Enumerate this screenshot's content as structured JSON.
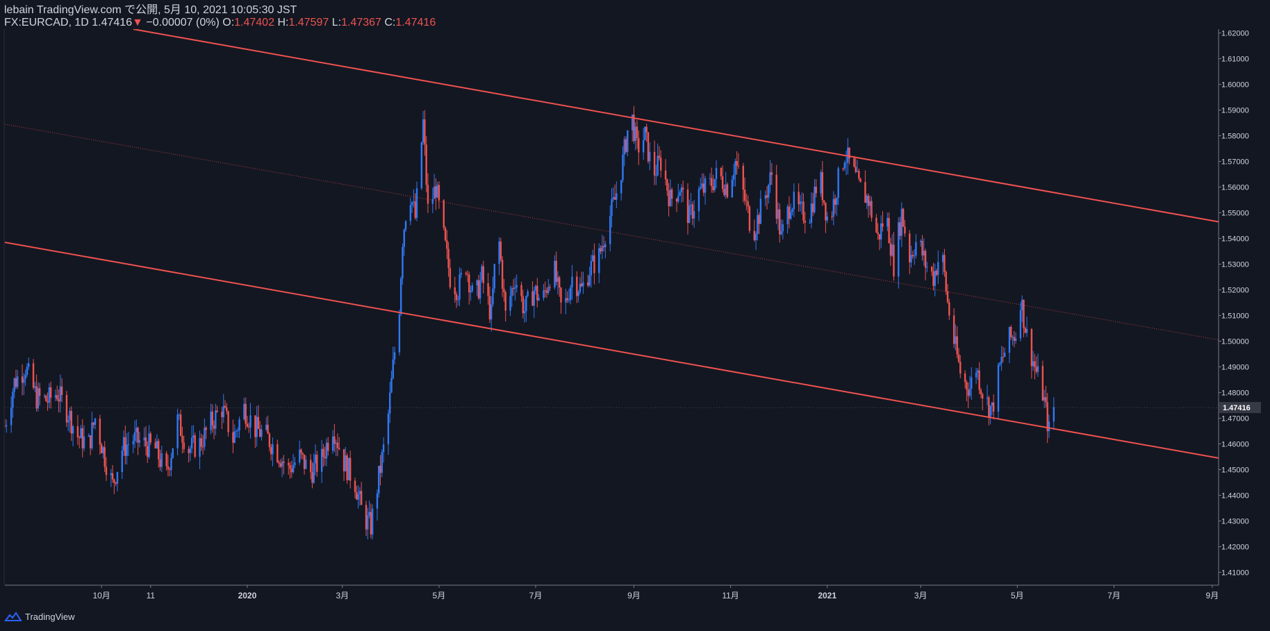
{
  "header": {
    "publish_line": "lebain TradingView.com で公開, 5月 10, 2021 10:05:30 JST",
    "symbol": "FX:EURCAD, 1D",
    "last": "1.47416",
    "arrow": "▼",
    "change": "−0.00007 (0%)",
    "o_label": "O:",
    "o_value": "1.47402",
    "h_label": "H:",
    "h_value": "1.47597",
    "l_label": "L:",
    "l_value": "1.47367",
    "c_label": "C:",
    "c_value": "1.47416"
  },
  "footer": {
    "brand": "TradingView"
  },
  "colors": {
    "background": "#131722",
    "up": "#2962ff",
    "up_light": "#3179f5",
    "down": "#ef5350",
    "channel": "#f0524f",
    "axis_text": "#d1d4dc",
    "price_tag_bg": "#363a45"
  },
  "chart_data": {
    "type": "candlestick",
    "title": "",
    "ylim": [
      1.405,
      1.6215
    ],
    "y_ticks": [
      "1.41000",
      "1.42000",
      "1.43000",
      "1.44000",
      "1.45000",
      "1.46000",
      "1.47000",
      "1.48000",
      "1.49000",
      "1.50000",
      "1.51000",
      "1.52000",
      "1.53000",
      "1.54000",
      "1.55000",
      "1.56000",
      "1.57000",
      "1.58000",
      "1.59000",
      "1.60000",
      "1.61000",
      "1.62000"
    ],
    "y_tick_values": [
      1.41,
      1.42,
      1.43,
      1.44,
      1.45,
      1.46,
      1.47,
      1.48,
      1.49,
      1.5,
      1.51,
      1.52,
      1.53,
      1.54,
      1.55,
      1.56,
      1.57,
      1.58,
      1.59,
      1.6,
      1.61,
      1.62
    ],
    "x_tick_labels": [
      "10月",
      "11",
      "2020",
      "3月",
      "5月",
      "7月",
      "9月",
      "11月",
      "2021",
      "3月",
      "5月",
      "7月",
      "9月"
    ],
    "x_tick_dates": [
      "2019-10-01",
      "2019-11-01",
      "2020-01-01",
      "2020-03-01",
      "2020-05-01",
      "2020-07-01",
      "2020-09-01",
      "2020-11-01",
      "2021-01-01",
      "2021-03-01",
      "2021-05-01",
      "2021-07-01",
      "2021-09-01"
    ],
    "x_range": [
      "2019-08-01",
      "2021-09-05"
    ],
    "last_price": 1.47416,
    "last_price_label": "1.47416",
    "path_points": [
      [
        "2019-08-01",
        1.467
      ],
      [
        "2019-08-07",
        1.484
      ],
      [
        "2019-08-14",
        1.49
      ],
      [
        "2019-08-21",
        1.478
      ],
      [
        "2019-08-28",
        1.477
      ],
      [
        "2019-09-03",
        1.48
      ],
      [
        "2019-09-10",
        1.472
      ],
      [
        "2019-09-16",
        1.463
      ],
      [
        "2019-09-23",
        1.46
      ],
      [
        "2019-09-27",
        1.47
      ],
      [
        "2019-10-03",
        1.455
      ],
      [
        "2019-10-08",
        1.444
      ],
      [
        "2019-10-14",
        1.458
      ],
      [
        "2019-10-21",
        1.462
      ],
      [
        "2019-10-28",
        1.46
      ],
      [
        "2019-11-04",
        1.458
      ],
      [
        "2019-11-11",
        1.448
      ],
      [
        "2019-11-18",
        1.469
      ],
      [
        "2019-11-25",
        1.458
      ],
      [
        "2019-12-02",
        1.46
      ],
      [
        "2019-12-09",
        1.468
      ],
      [
        "2019-12-16",
        1.474
      ],
      [
        "2019-12-23",
        1.462
      ],
      [
        "2019-12-30",
        1.474
      ],
      [
        "2020-01-06",
        1.466
      ],
      [
        "2020-01-13",
        1.463
      ],
      [
        "2020-01-20",
        1.457
      ],
      [
        "2020-01-27",
        1.45
      ],
      [
        "2020-02-03",
        1.455
      ],
      [
        "2020-02-10",
        1.449
      ],
      [
        "2020-02-17",
        1.454
      ],
      [
        "2020-02-24",
        1.467
      ],
      [
        "2020-03-02",
        1.453
      ],
      [
        "2020-03-09",
        1.445
      ],
      [
        "2020-03-14",
        1.432
      ],
      [
        "2020-03-19",
        1.428
      ],
      [
        "2020-03-24",
        1.447
      ],
      [
        "2020-03-29",
        1.465
      ],
      [
        "2020-04-02",
        1.49
      ],
      [
        "2020-04-06",
        1.514
      ],
      [
        "2020-04-08",
        1.54
      ],
      [
        "2020-04-12",
        1.56
      ],
      [
        "2020-04-16",
        1.548
      ],
      [
        "2020-04-21",
        1.585
      ],
      [
        "2020-04-24",
        1.551
      ],
      [
        "2020-04-29",
        1.56
      ],
      [
        "2020-05-04",
        1.54
      ],
      [
        "2020-05-08",
        1.525
      ],
      [
        "2020-05-13",
        1.52
      ],
      [
        "2020-05-18",
        1.53
      ],
      [
        "2020-05-23",
        1.515
      ],
      [
        "2020-05-28",
        1.525
      ],
      [
        "2020-06-03",
        1.51
      ],
      [
        "2020-06-07",
        1.545
      ],
      [
        "2020-06-12",
        1.51
      ],
      [
        "2020-06-18",
        1.525
      ],
      [
        "2020-06-24",
        1.512
      ],
      [
        "2020-06-30",
        1.52
      ],
      [
        "2020-07-05",
        1.515
      ],
      [
        "2020-07-12",
        1.53
      ],
      [
        "2020-07-18",
        1.51
      ],
      [
        "2020-07-24",
        1.525
      ],
      [
        "2020-07-30",
        1.52
      ],
      [
        "2020-08-04",
        1.528
      ],
      [
        "2020-08-10",
        1.533
      ],
      [
        "2020-08-15",
        1.545
      ],
      [
        "2020-08-20",
        1.555
      ],
      [
        "2020-08-25",
        1.57
      ],
      [
        "2020-08-30",
        1.59
      ],
      [
        "2020-09-03",
        1.575
      ],
      [
        "2020-09-08",
        1.58
      ],
      [
        "2020-09-13",
        1.565
      ],
      [
        "2020-09-18",
        1.57
      ],
      [
        "2020-09-24",
        1.555
      ],
      [
        "2020-09-30",
        1.56
      ],
      [
        "2020-10-06",
        1.548
      ],
      [
        "2020-10-12",
        1.558
      ],
      [
        "2020-10-18",
        1.56
      ],
      [
        "2020-10-24",
        1.565
      ],
      [
        "2020-10-30",
        1.56
      ],
      [
        "2020-11-04",
        1.57
      ],
      [
        "2020-11-10",
        1.555
      ],
      [
        "2020-11-15",
        1.542
      ],
      [
        "2020-11-21",
        1.553
      ],
      [
        "2020-11-27",
        1.565
      ],
      [
        "2020-12-03",
        1.54
      ],
      [
        "2020-12-09",
        1.555
      ],
      [
        "2020-12-15",
        1.55
      ],
      [
        "2020-12-21",
        1.55
      ],
      [
        "2020-12-27",
        1.565
      ],
      [
        "2021-01-02",
        1.545
      ],
      [
        "2021-01-07",
        1.56
      ],
      [
        "2021-01-12",
        1.573
      ],
      [
        "2021-01-16",
        1.568
      ],
      [
        "2021-01-21",
        1.56
      ],
      [
        "2021-01-27",
        1.555
      ],
      [
        "2021-02-02",
        1.54
      ],
      [
        "2021-02-07",
        1.55
      ],
      [
        "2021-02-12",
        1.53
      ],
      [
        "2021-02-17",
        1.55
      ],
      [
        "2021-02-22",
        1.533
      ],
      [
        "2021-02-27",
        1.54
      ],
      [
        "2021-03-04",
        1.53
      ],
      [
        "2021-03-09",
        1.525
      ],
      [
        "2021-03-14",
        1.536
      ],
      [
        "2021-03-18",
        1.515
      ],
      [
        "2021-03-22",
        1.5
      ],
      [
        "2021-03-27",
        1.485
      ],
      [
        "2021-04-01",
        1.482
      ],
      [
        "2021-04-05",
        1.49
      ],
      [
        "2021-04-10",
        1.478
      ],
      [
        "2021-04-15",
        1.473
      ],
      [
        "2021-04-20",
        1.49
      ],
      [
        "2021-04-25",
        1.5
      ],
      [
        "2021-04-30",
        1.503
      ],
      [
        "2021-05-03",
        1.517
      ],
      [
        "2021-05-07",
        1.502
      ],
      [
        "2021-05-12",
        1.49
      ],
      [
        "2021-05-17",
        1.48
      ],
      [
        "2021-05-21",
        1.465
      ],
      [
        "2021-05-24",
        1.474
      ]
    ],
    "channel_lines": [
      {
        "name": "upper",
        "start": [
          "2019-10-21",
          1.6215
        ],
        "end": [
          "2021-09-05",
          1.5465
        ],
        "color": "#f0524f",
        "style": "solid"
      },
      {
        "name": "lower",
        "start": [
          "2019-08-01",
          1.5385
        ],
        "end": [
          "2021-09-05",
          1.4545
        ],
        "color": "#f0524f",
        "style": "solid"
      },
      {
        "name": "mid",
        "start": [
          "2019-08-01",
          1.5845
        ],
        "end": [
          "2021-09-05",
          1.5005
        ],
        "color": "#f0524f",
        "style": "dotted"
      }
    ]
  }
}
